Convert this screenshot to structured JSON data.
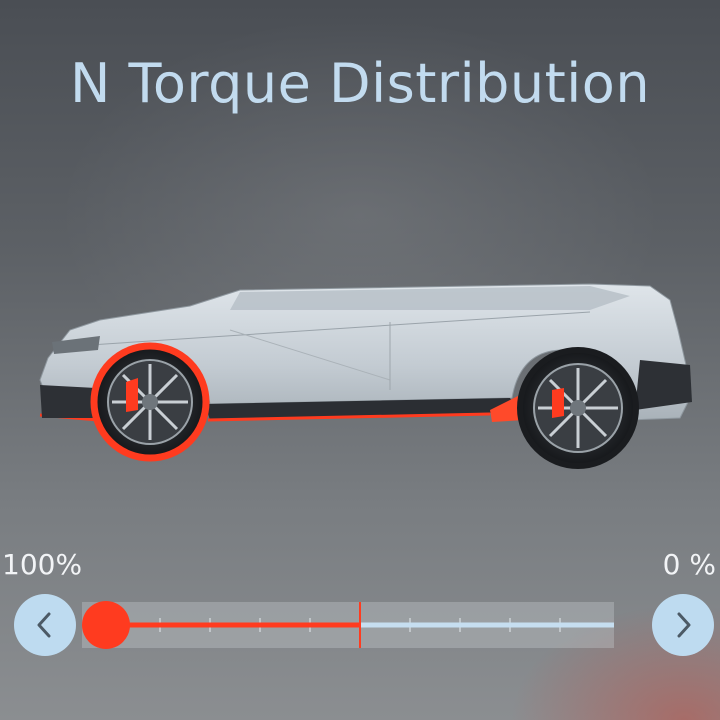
{
  "title": "N Torque Distribution",
  "torque": {
    "front_label": "100%",
    "rear_label": "0 %",
    "front_percent": 100,
    "rear_percent": 0
  },
  "colors": {
    "accent_red": "#ff3b1f",
    "accent_blue": "#bedbf0",
    "title_blue": "#c2dbef",
    "car_body": "#c8d0d6"
  },
  "icons": {
    "decrease": "chevron-left-icon",
    "increase": "chevron-right-icon"
  }
}
